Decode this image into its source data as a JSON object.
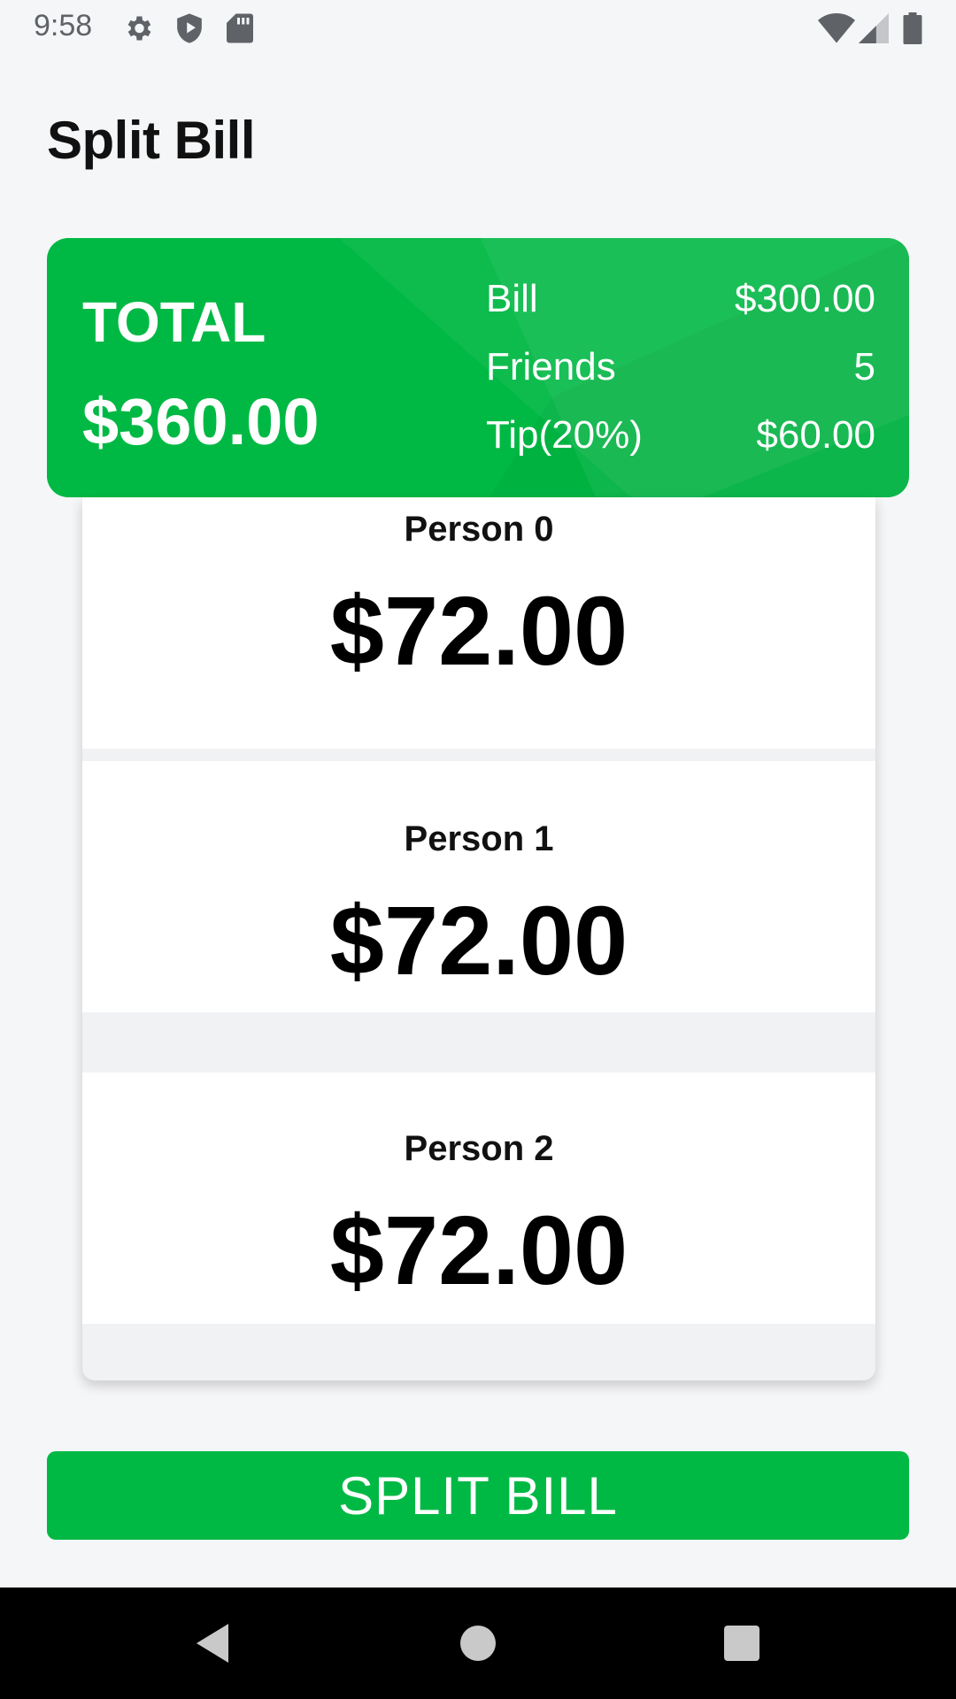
{
  "status_bar": {
    "time": "9:58",
    "left_icons": [
      "settings-icon",
      "play-protect-icon",
      "sd-card-icon"
    ],
    "right_icons": [
      "wifi-icon",
      "cell-signal-icon",
      "battery-icon"
    ]
  },
  "page": {
    "title": "Split Bill"
  },
  "summary": {
    "total_label": "TOTAL",
    "total_amount": "$360.00",
    "rows": [
      {
        "label": "Bill",
        "value": "$300.00"
      },
      {
        "label": "Friends",
        "value": "5"
      },
      {
        "label": "Tip(20%)",
        "value": "$60.00"
      }
    ]
  },
  "people": [
    {
      "name": "Person 0",
      "amount": "$72.00"
    },
    {
      "name": "Person 1",
      "amount": "$72.00"
    },
    {
      "name": "Person 2",
      "amount": "$72.00"
    }
  ],
  "action": {
    "split_label": "SPLIT BILL"
  },
  "colors": {
    "accent": "#00b944",
    "background": "#f5f6f8"
  },
  "nav": {
    "buttons": [
      "back-icon",
      "home-icon",
      "recents-icon"
    ]
  }
}
